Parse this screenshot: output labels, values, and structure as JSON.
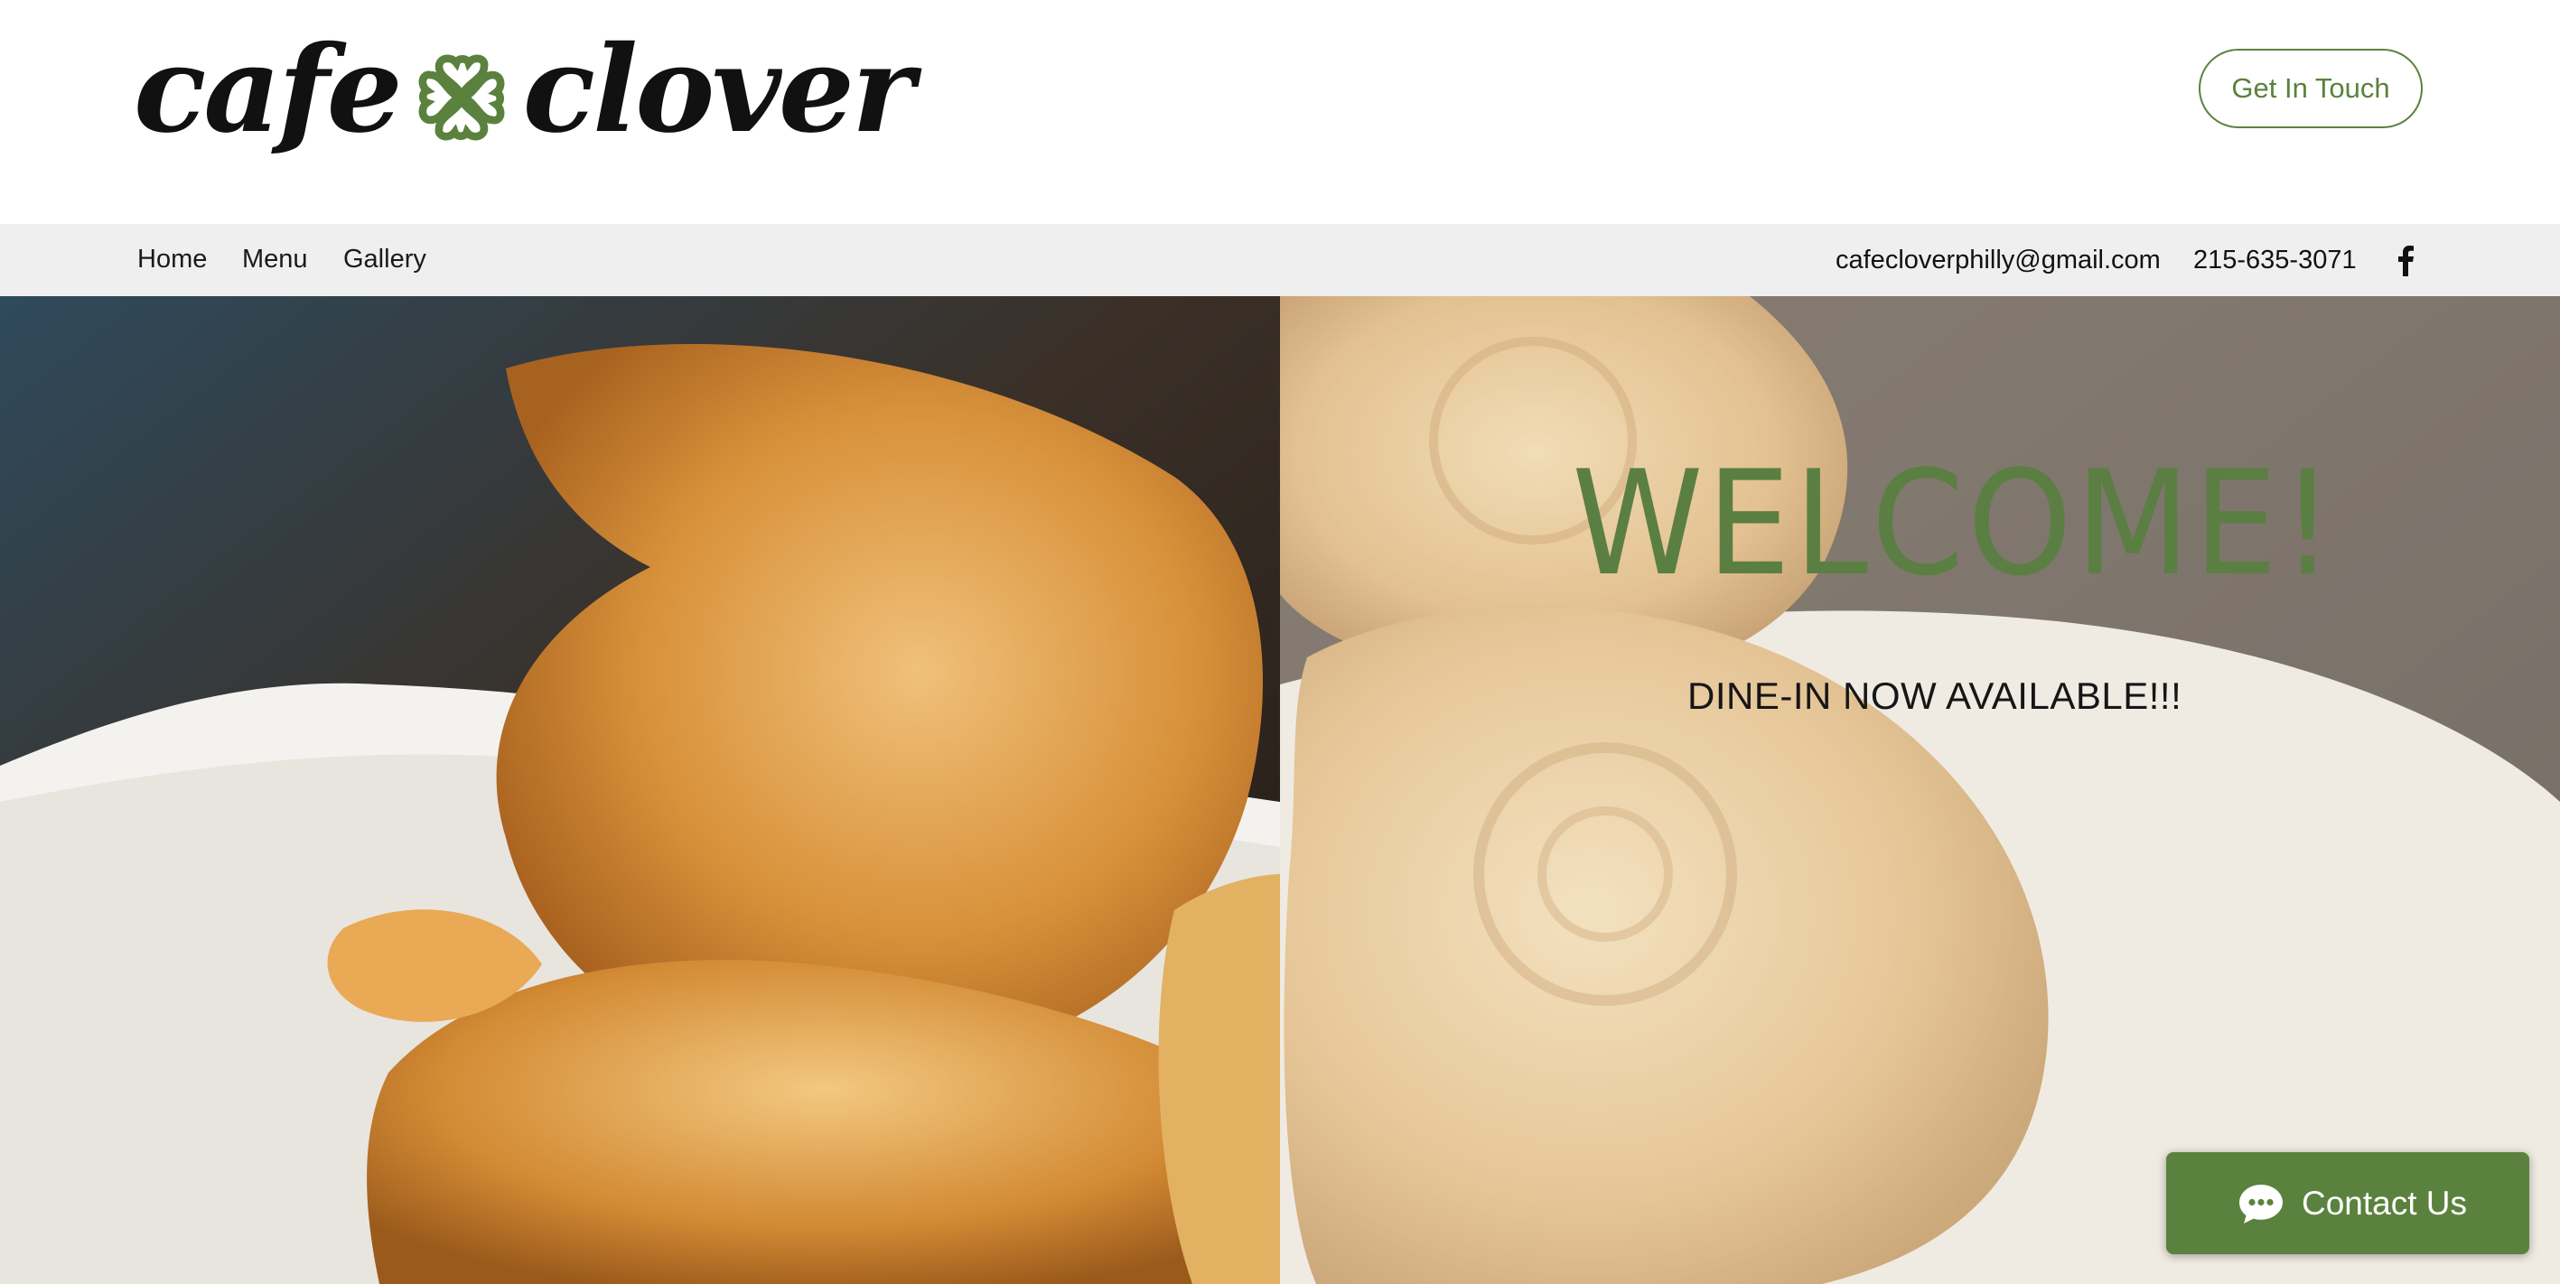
{
  "brand": {
    "logo_left": "cafe",
    "logo_right": "clover",
    "logo_icon": "clover-icon",
    "accent_color": "#5a823e"
  },
  "header": {
    "cta_label": "Get In Touch"
  },
  "nav": {
    "items": [
      {
        "label": "Home"
      },
      {
        "label": "Menu"
      },
      {
        "label": "Gallery"
      }
    ],
    "email": "cafecloverphilly@gmail.com",
    "phone": "215-635-3071",
    "social_icon": "facebook-icon"
  },
  "hero": {
    "heading": "WELCOME!",
    "subheading": "DINE-IN NOW AVAILABLE!!!",
    "image_subject": "taiyaki fish-shaped pastries on a white plate"
  },
  "chat": {
    "label": "Contact Us",
    "icon": "chat-bubble-icon"
  }
}
